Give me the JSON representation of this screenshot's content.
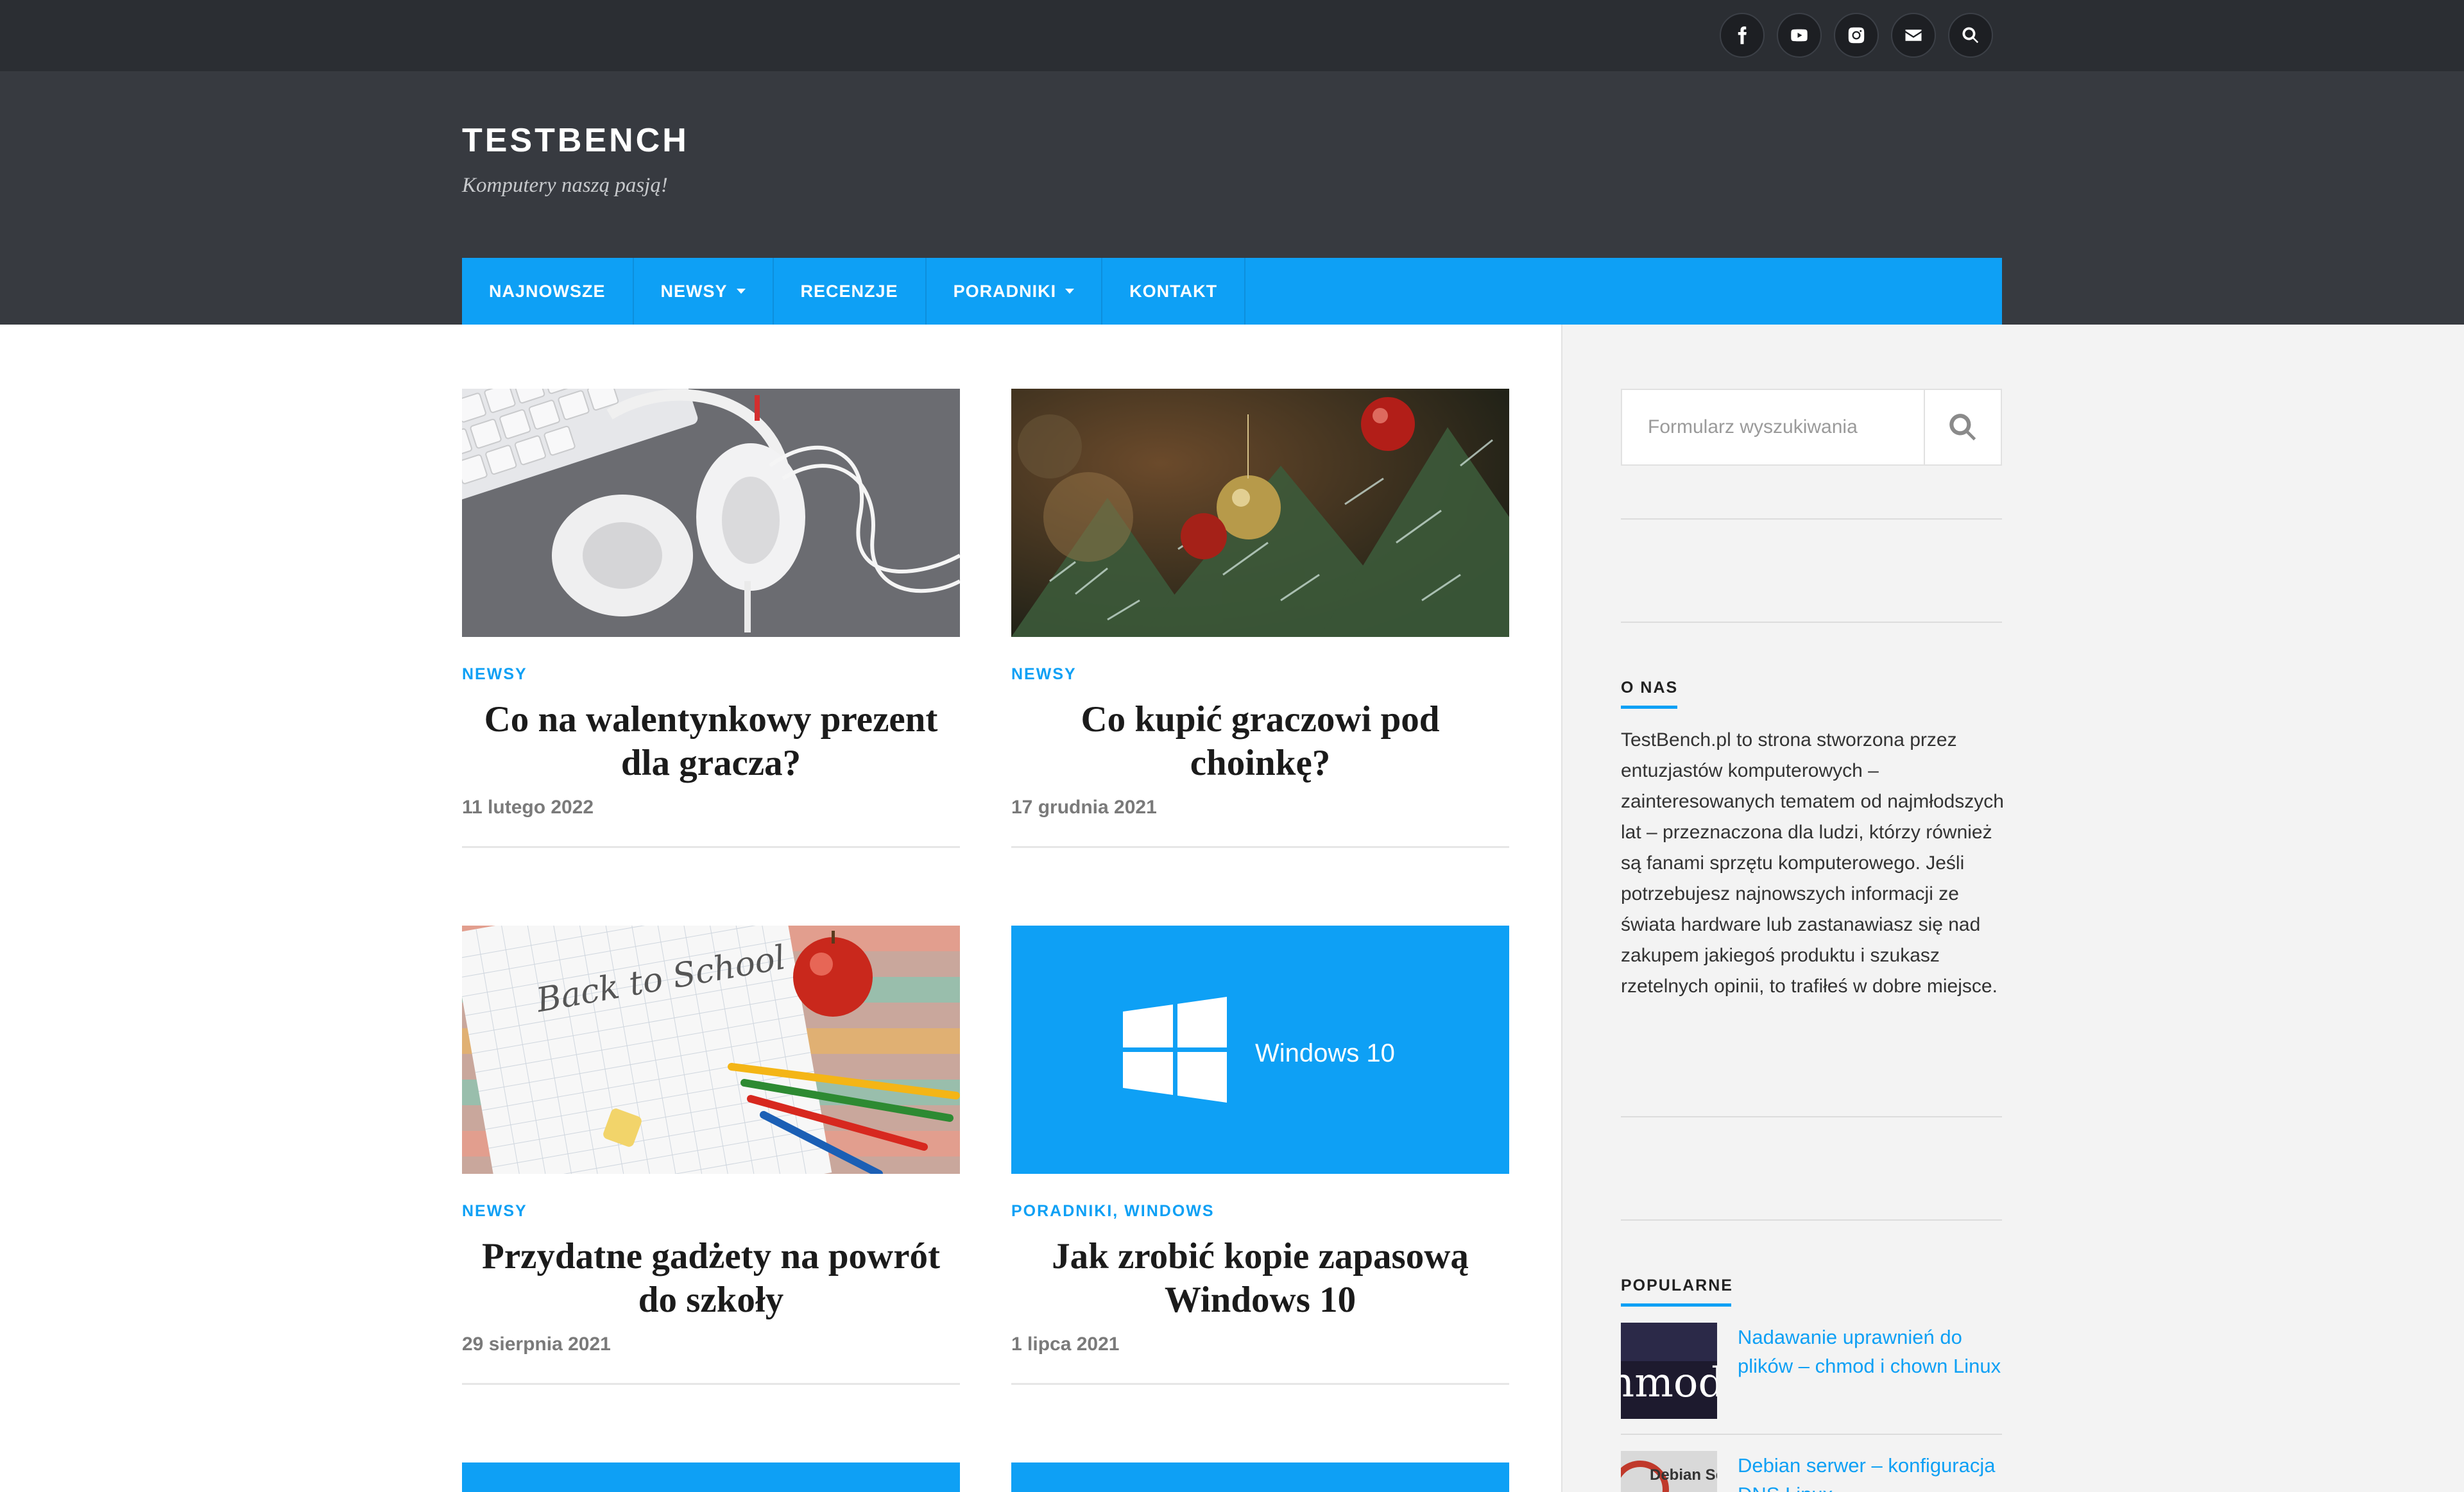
{
  "colors": {
    "accent": "#0ea0f5",
    "topbar": "#2b2e33",
    "header": "#373a40"
  },
  "social": [
    {
      "icon": "facebook-icon"
    },
    {
      "icon": "youtube-icon"
    },
    {
      "icon": "instagram-icon"
    },
    {
      "icon": "mail-icon"
    },
    {
      "icon": "search-icon"
    }
  ],
  "header": {
    "title": "TESTBENCH",
    "tagline": "Komputery naszą pasją!"
  },
  "nav": [
    {
      "label": "NAJNOWSZE",
      "dropdown": false
    },
    {
      "label": "NEWSY",
      "dropdown": true
    },
    {
      "label": "RECENZJE",
      "dropdown": false
    },
    {
      "label": "PORADNIKI",
      "dropdown": true
    },
    {
      "label": "KONTAKT",
      "dropdown": false
    }
  ],
  "posts": [
    {
      "category": "NEWSY",
      "title": "Co na walentynkowy prezent dla gracza?",
      "date": "11 lutego 2022"
    },
    {
      "category": "NEWSY",
      "title": "Co kupić graczowi pod choinkę?",
      "date": "17 grudnia 2021"
    },
    {
      "category": "NEWSY",
      "title": "Przydatne gadżety na powrót do szkoły",
      "date": "29 sierpnia 2021"
    },
    {
      "category": "PORADNIKI, WINDOWS",
      "title": "Jak zrobić kopie zapasową Windows 10",
      "date": "1 lipca 2021",
      "image_text": "Windows 10"
    }
  ],
  "back_to_school_text": "Back to School",
  "sidebar": {
    "search_placeholder": "Formularz wyszukiwania",
    "about_title": "O NAS",
    "about_text": "TestBench.pl to strona stworzona przez entuzjastów komputerowych – zainteresowanych tematem od najmłodszych lat – przeznaczona dla ludzi, którzy również są fanami sprzętu komputerowego. Jeśli potrzebujesz najnowszych informacji ze świata hardware lub zastanawiasz się nad zakupem jakiegoś produktu i szukasz rzetelnych opinii, to trafiłeś w dobre miejsce.",
    "popular_title": "POPULARNE",
    "popular": [
      {
        "title": "Nadawanie uprawnień do plików – chmod i chown Linux",
        "thumb_text": "hmod"
      },
      {
        "title": "Debian serwer – konfiguracja DNS Linux",
        "thumb_text": "Debian Se"
      }
    ]
  }
}
